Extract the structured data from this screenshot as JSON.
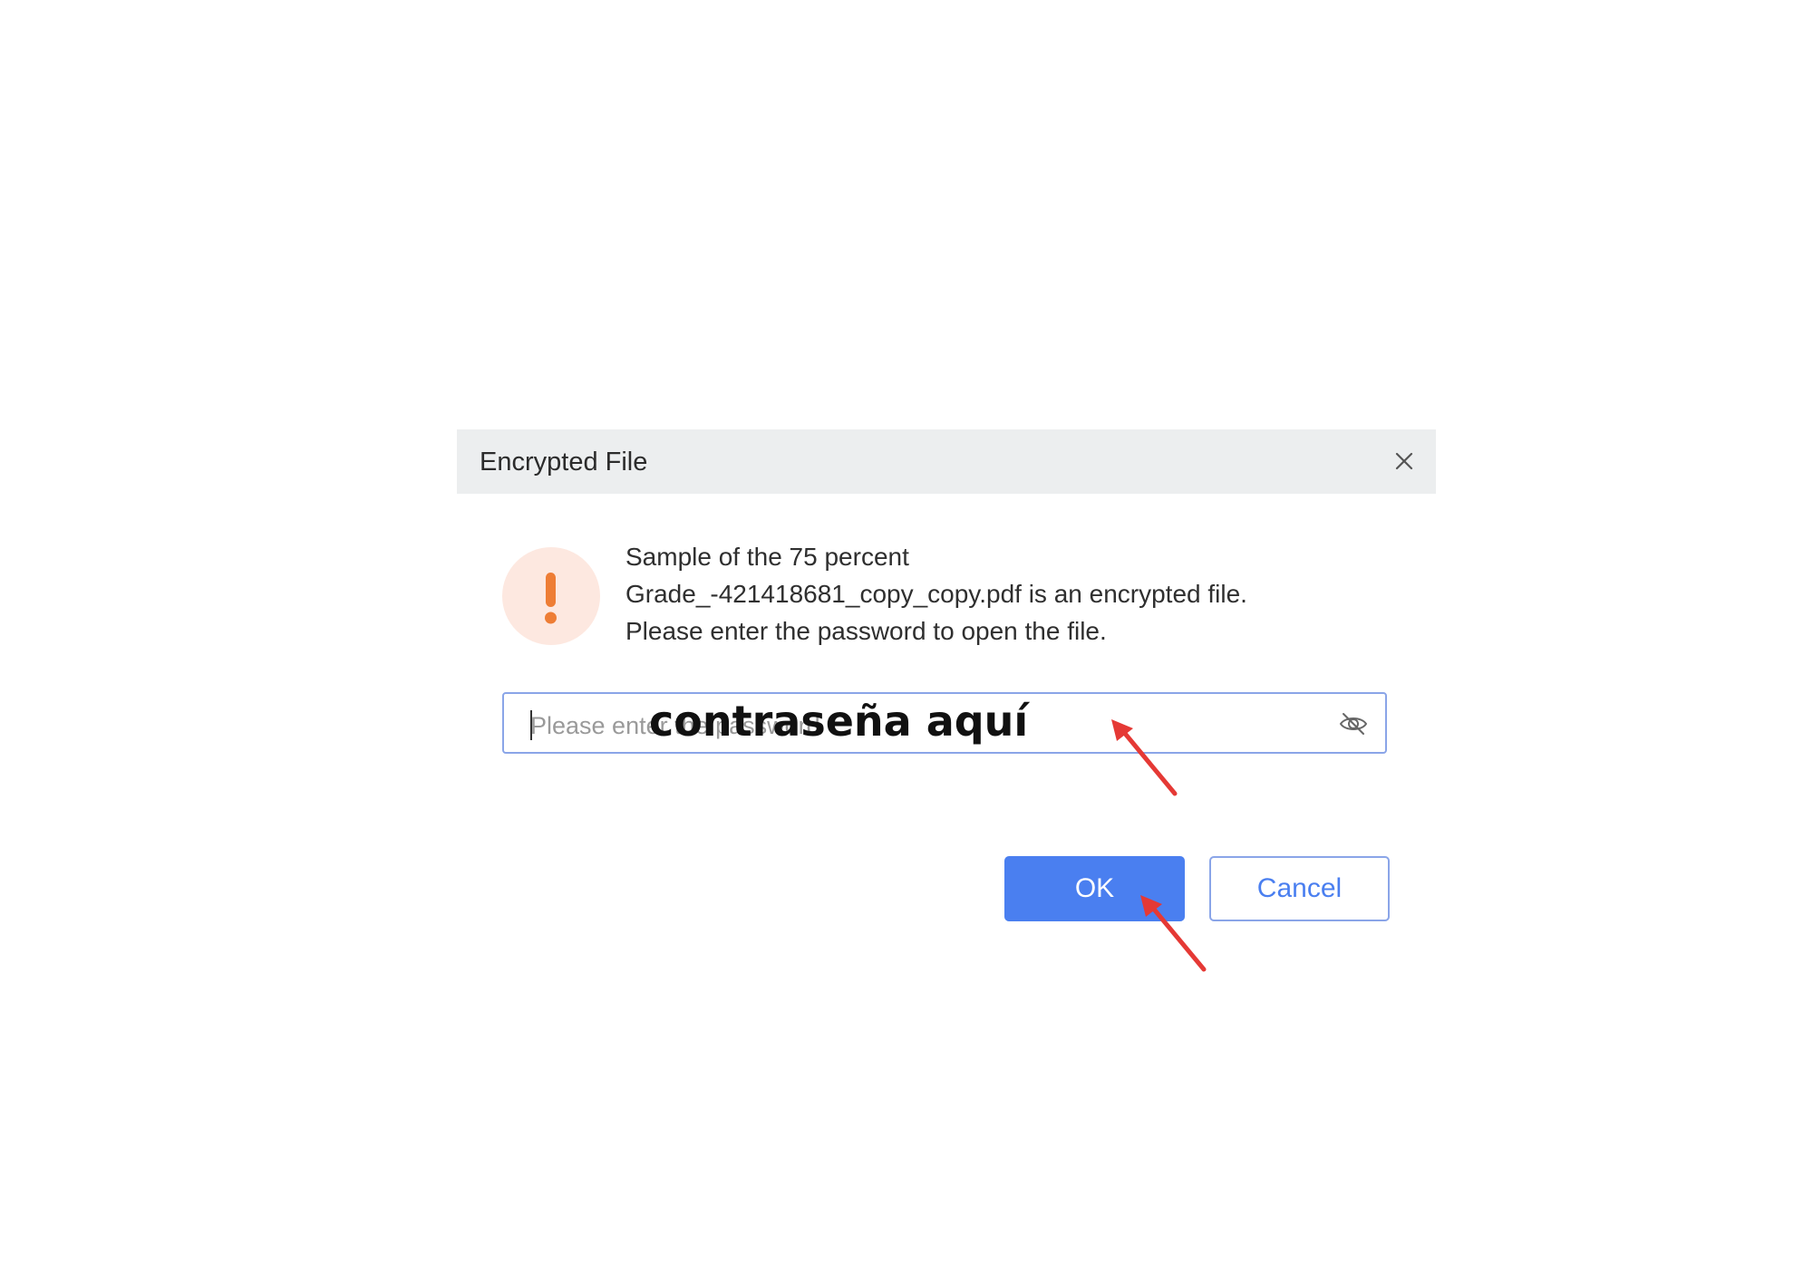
{
  "dialog": {
    "title": "Encrypted File",
    "close_icon": "close-icon",
    "warning_icon": "exclamation-icon",
    "message_lines": [
      "Sample of the 75 percent",
      "Grade_-421418681_copy_copy.pdf is an encrypted file.",
      "Please enter the password to open the file."
    ],
    "password_input": {
      "placeholder": "Please enter the password",
      "value": "",
      "visibility_icon": "eye-slash-icon"
    },
    "ok_label": "OK",
    "cancel_label": "Cancel"
  },
  "annotation": {
    "overlay_text": "contraseña aquí",
    "arrow_color": "#e53935"
  },
  "colors": {
    "accent": "#4a7ff0",
    "titlebar": "#eceeef",
    "warning": "#ee7d35",
    "warning_bg": "#fde8e0"
  }
}
